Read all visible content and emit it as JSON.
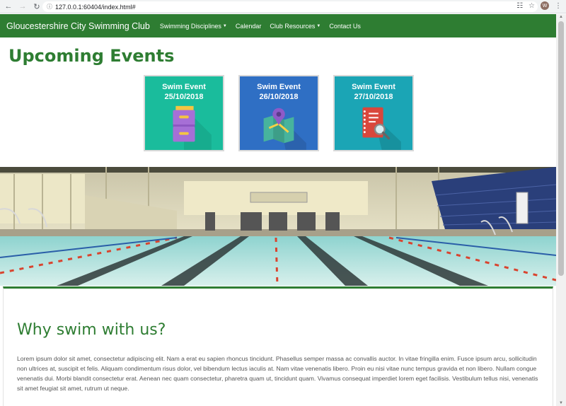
{
  "browser": {
    "url": "127.0.0.1:60404/index.html#",
    "back_icon": "arrow-left-icon",
    "forward_icon": "arrow-right-icon",
    "reload_icon": "reload-icon",
    "profile_initial": "W"
  },
  "navbar": {
    "brand": "Gloucestershire City Swimming Club",
    "items": [
      {
        "label": "Swimming Disciplines",
        "dropdown": true
      },
      {
        "label": "Calendar",
        "dropdown": false
      },
      {
        "label": "Club Resources",
        "dropdown": true
      },
      {
        "label": "Contact Us",
        "dropdown": false
      }
    ],
    "color": "#2e7d32"
  },
  "events": {
    "heading": "Upcoming Events",
    "cards": [
      {
        "title": "Swim Event",
        "date": "25/10/2018",
        "color": "#1abc9c",
        "icon": "drawer-cabinet-icon"
      },
      {
        "title": "Swim Event",
        "date": "26/10/2018",
        "color": "#2f6fc4",
        "icon": "map-pin-icon"
      },
      {
        "title": "Swim Event",
        "date": "27/10/2018",
        "color": "#1ba5b5",
        "icon": "notebook-search-icon"
      }
    ]
  },
  "banner": {
    "icon": "swimming-pool-photo"
  },
  "why": {
    "heading": "Why swim with us?",
    "body": "Lorem ipsum dolor sit amet, consectetur adipiscing elit. Nam a erat eu sapien rhoncus tincidunt. Phasellus semper massa ac convallis auctor. In vitae fringilla enim. Fusce ipsum arcu, sollicitudin non ultrices at, suscipit et felis. Aliquam condimentum risus dolor, vel bibendum lectus iaculis at. Nam vitae venenatis libero. Proin eu nisi vitae nunc tempus gravida et non libero. Nullam congue venenatis dui. Morbi blandit consectetur erat. Aenean nec quam consectetur, pharetra quam ut, tincidunt quam. Vivamus consequat imperdiet lorem eget facilisis. Vestibulum tellus nisi, venenatis sit amet feugiat sit amet, rutrum ut neque."
  }
}
